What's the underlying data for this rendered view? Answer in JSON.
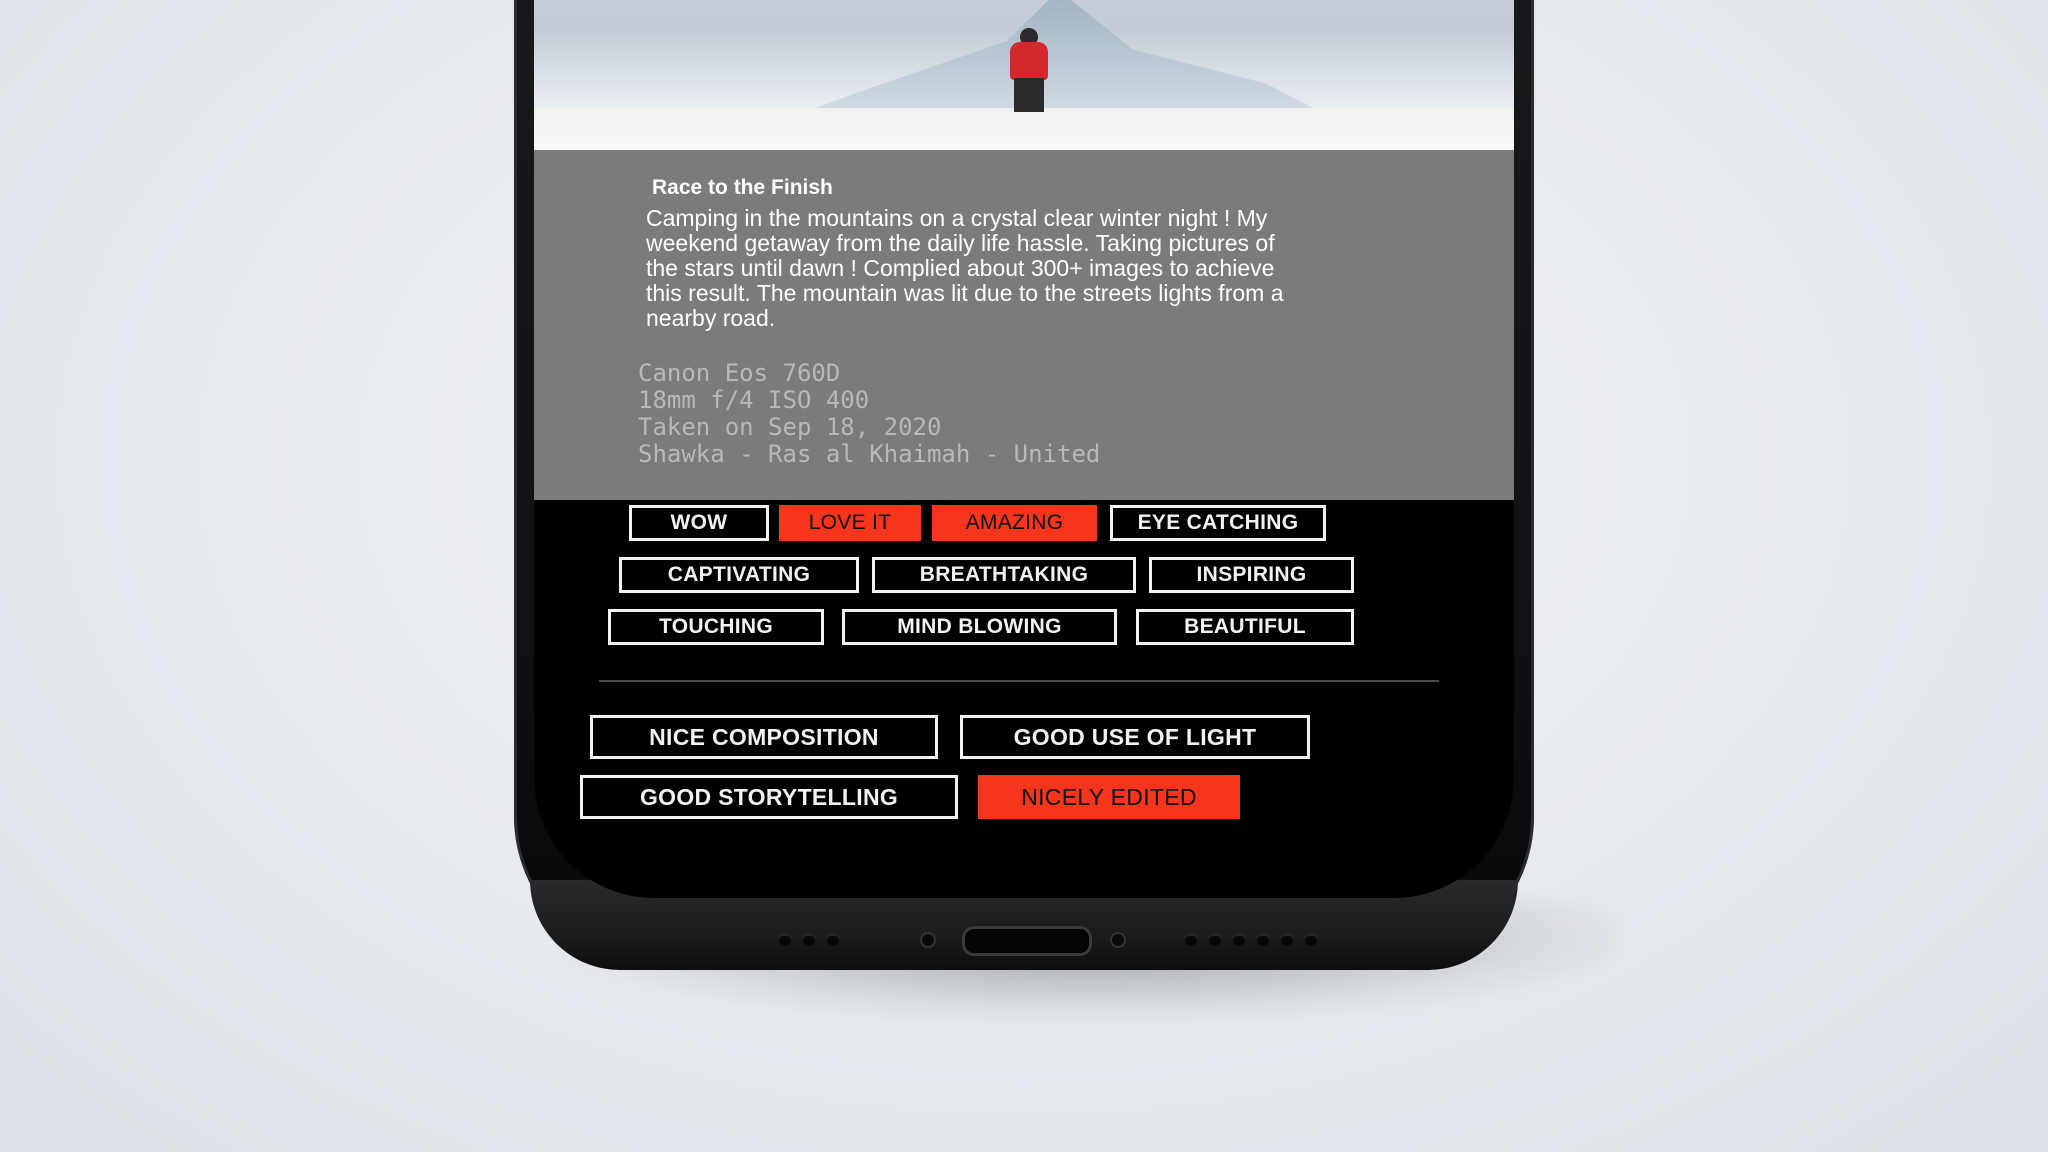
{
  "post": {
    "title": "Race to the Finish",
    "description": "Camping in the mountains on a crystal clear winter night ! My weekend getaway from the daily life hassle. Taking pictures of the stars until dawn ! Complied about 300+ images to achieve this result.  The mountain was lit due to the streets lights from a nearby road.",
    "camera": "Canon Eos 760D",
    "settings": "18mm f/4 ISO 400",
    "taken": "Taken on Sep 18, 2020",
    "location": "Shawka - Ras al Khaimah - United"
  },
  "reactions": [
    {
      "label": "WOW",
      "active": false
    },
    {
      "label": "LOVE IT",
      "active": true
    },
    {
      "label": "AMAZING",
      "active": true
    },
    {
      "label": "EYE CATCHING",
      "active": false
    },
    {
      "label": "CAPTIVATING",
      "active": false
    },
    {
      "label": "BREATHTAKING",
      "active": false
    },
    {
      "label": "INSPIRING",
      "active": false
    },
    {
      "label": "TOUCHING",
      "active": false
    },
    {
      "label": "MIND BLOWING",
      "active": false
    },
    {
      "label": "BEAUTIFUL",
      "active": false
    }
  ],
  "feedback": [
    {
      "label": "NICE COMPOSITION",
      "active": false
    },
    {
      "label": "GOOD USE OF LIGHT",
      "active": false
    },
    {
      "label": "GOOD STORYTELLING",
      "active": false
    },
    {
      "label": "NICELY EDITED",
      "active": true
    }
  ],
  "colors": {
    "accent": "#f5351c",
    "info_panel": "#7b7b7b",
    "screen_bg": "#000000",
    "tag_border": "#f2f2f2"
  }
}
